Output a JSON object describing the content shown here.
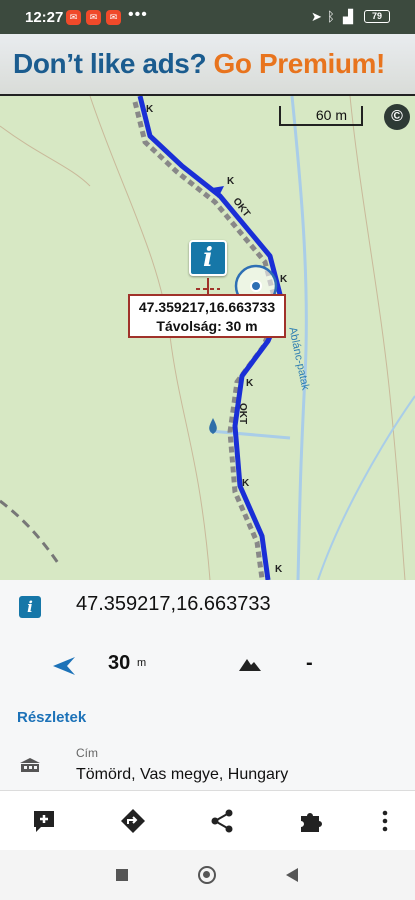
{
  "status_bar": {
    "time": "12:27",
    "battery": "79",
    "notification_icons": [
      "mail-notification-icon",
      "mail-notification-icon",
      "mail-notification-icon"
    ],
    "overflow": "•••"
  },
  "ad_banner": {
    "text_part1": "Don’t like ads?",
    "text_part2": "Go Premium!",
    "color_part1": "#1b5c8f",
    "color_part2": "#e8741e"
  },
  "map": {
    "scale_label": "60 m",
    "copyright_symbol": "©",
    "info_marker_glyph": "i",
    "coordinate_label": "47.359217,16.663733",
    "distance_label": "Távolság: 30 m",
    "stream_label": "Ablánc-patak",
    "trail_labels": [
      "K",
      "K",
      "OKT",
      "K",
      "K",
      "OKT",
      "K",
      "K"
    ],
    "route_color": "#1a2fd6",
    "map_bg_color": "#d7e8c4"
  },
  "info_panel": {
    "icon_glyph": "i",
    "coordinates": "47.359217,16.663733",
    "distance_value": "30",
    "distance_unit": "m",
    "elevation_value": "-",
    "details_link": "Részletek",
    "address_label": "Cím",
    "address_value": "Tömörd, Vas megye, Hungary",
    "accent_color": "#1c72b8"
  },
  "toolbar": {
    "buttons": [
      "add-note-icon",
      "navigate-icon",
      "share-icon",
      "plugin-icon",
      "more-vert-icon"
    ]
  },
  "nav_bar": {
    "buttons": [
      "recents-button",
      "home-button",
      "back-button"
    ]
  }
}
